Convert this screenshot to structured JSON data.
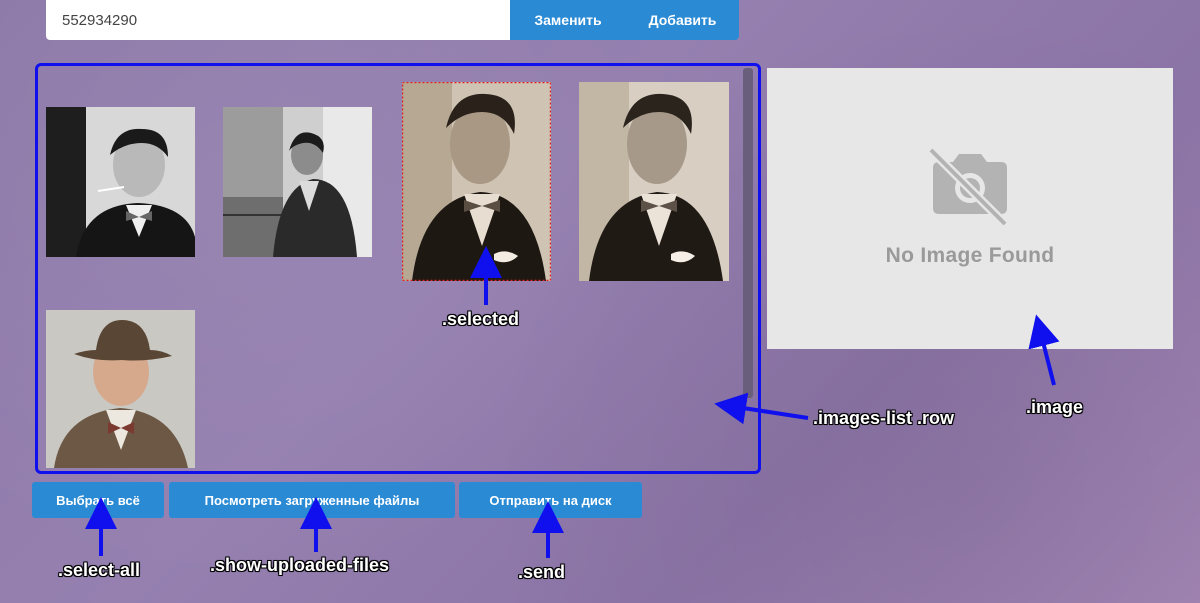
{
  "top_bar": {
    "input_value": "552934290",
    "replace_label": "Заменить",
    "add_label": "Добавить"
  },
  "images_list": {
    "thumbnails": [
      {
        "id": "photo-1",
        "style": "bw",
        "selected": false
      },
      {
        "id": "photo-2",
        "style": "bw",
        "selected": false
      },
      {
        "id": "photo-3",
        "style": "sepia",
        "selected": true
      },
      {
        "id": "photo-4",
        "style": "sepia",
        "selected": false
      },
      {
        "id": "photo-5",
        "style": "color",
        "selected": false
      }
    ]
  },
  "image_preview": {
    "icon": "camera-off-icon",
    "text": "No Image Found"
  },
  "buttons": {
    "select_all": "Выбрать всё",
    "show_uploaded": "Посмотреть загруженные файлы",
    "send": "Отправить на диск"
  },
  "annotations": {
    "selected": ".selected",
    "images_list_row": ".images-list .row",
    "image": ".image",
    "select_all": ".select-all",
    "show_uploaded_files": ".show-uploaded-files",
    "send": ".send"
  },
  "colors": {
    "accent": "#2a8ad4",
    "annotation_blue": "#1010ee",
    "selected_border": "#e02020"
  }
}
